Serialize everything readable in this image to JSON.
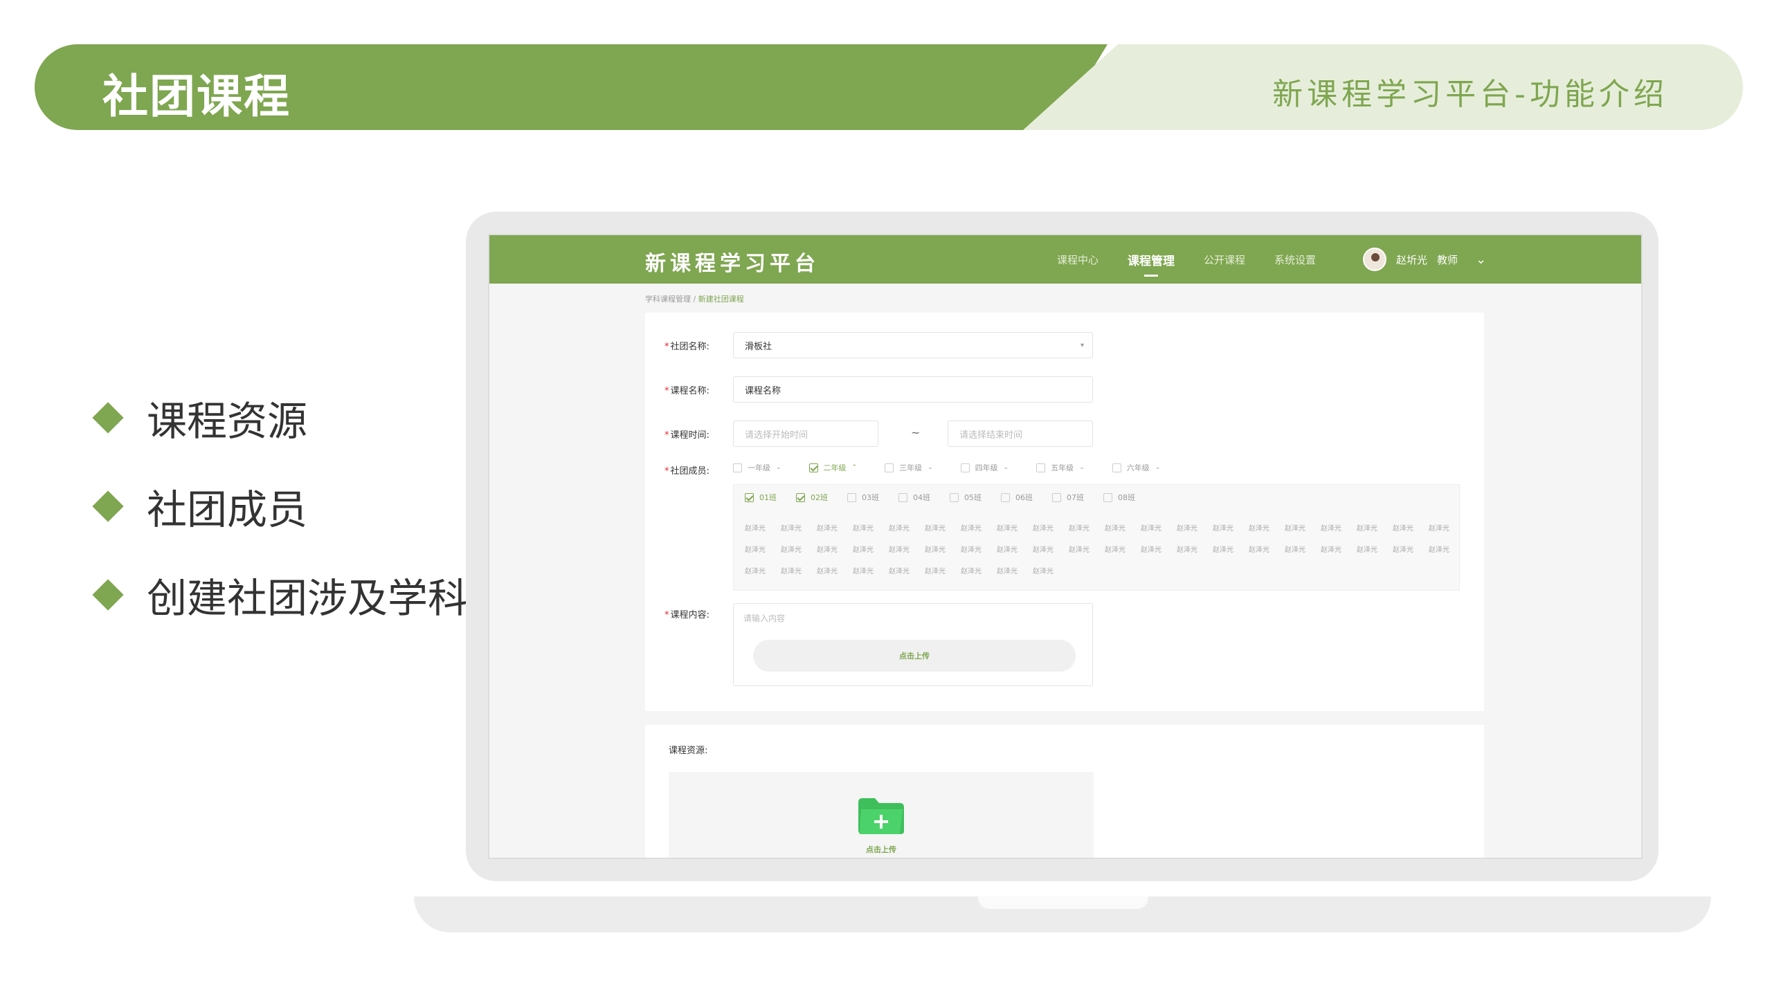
{
  "slide": {
    "title": "社团课程",
    "subtitle": "新课程学习平台-功能介绍",
    "bullets": [
      "课程资源",
      "社团成员",
      "创建社团涉及学科"
    ]
  },
  "app": {
    "logo": "新课程学习平台",
    "nav": [
      "课程中心",
      "课程管理",
      "公开课程",
      "系统设置"
    ],
    "active_nav": "课程管理",
    "user_name": "赵圻光",
    "user_role": "教师"
  },
  "breadcrumb": {
    "parent": "学科课程管理 / ",
    "current": "新建社团课程"
  },
  "form": {
    "club_label": "社团名称:",
    "club_value": "滑板社",
    "course_label": "课程名称:",
    "course_value": "课程名称",
    "time_label": "课程时间:",
    "start_placeholder": "请选择开始时间",
    "end_placeholder": "请选择结束时间",
    "tilde": "~",
    "members_label": "社团成员:",
    "grades": [
      "一年级",
      "二年级",
      "三年级",
      "四年级",
      "五年级",
      "六年级"
    ],
    "selected_grade": "二年级",
    "classes": [
      "01班",
      "02班",
      "03班",
      "04班",
      "05班",
      "06班",
      "07班",
      "08班"
    ],
    "selected_classes": [
      "01班",
      "02班"
    ],
    "member_name": "赵泽光",
    "member_count": 49,
    "content_label": "课程内容:",
    "content_placeholder": "请输入内容",
    "upload_label": "点击上传"
  },
  "resources": {
    "label": "课程资源:",
    "upload_label": "点击上传"
  },
  "colors": {
    "brand": "#7fa650",
    "brand_light": "#e6eedb",
    "folder": "#4cd26a"
  }
}
